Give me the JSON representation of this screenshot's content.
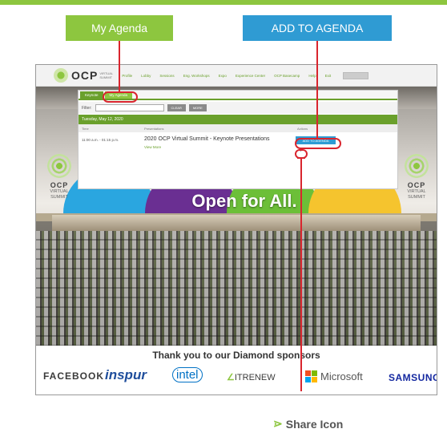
{
  "callouts": {
    "my_agenda": "My Agenda",
    "add_to_agenda": "ADD TO AGENDA",
    "share_icon": "Share Icon"
  },
  "nav": {
    "logo": "OCP",
    "logo_sub": "VIRTUAL SUMMIT",
    "links": [
      "Profile",
      "Lobby",
      "Sessions",
      "Eng. Workshops",
      "Expo",
      "Experience Center",
      "OCP Basecamp",
      "Help",
      "Exit"
    ]
  },
  "panel": {
    "tabs": [
      "Keynote",
      "My Agenda"
    ],
    "filter_label": "Filter:",
    "clear_label": "CLEAR",
    "more_label": "MORE",
    "date": "Tuesday, May 12, 2020",
    "columns": [
      "Time",
      "Presentations",
      "Actions"
    ],
    "session": {
      "time": "11:00 a.m. - 01:15 p.m.",
      "title": "2020 OCP Virtual Summit - Keynote Presentations",
      "view_more": "View More",
      "add_label": "ADD TO AGENDA",
      "share_glyph": "⋗"
    }
  },
  "stage": {
    "headline": "Open for All.",
    "side_logo": "OCP",
    "side_sub_1": "VIRTUAL",
    "side_sub_2": "SUMMIT"
  },
  "sponsors": {
    "title": "Thank you to our Diamond sponsors",
    "names": [
      "FACEBOOK",
      "inspur",
      "intel",
      "ITRENEW",
      "Microsoft",
      "SAMSUNG"
    ]
  },
  "colors": {
    "ocp_green": "#8dc63f",
    "dark_green": "#6aa02c",
    "accent_blue": "#2f9bd3",
    "annotation_red": "#d9252e"
  },
  "icons": {
    "share": "share-icon"
  }
}
